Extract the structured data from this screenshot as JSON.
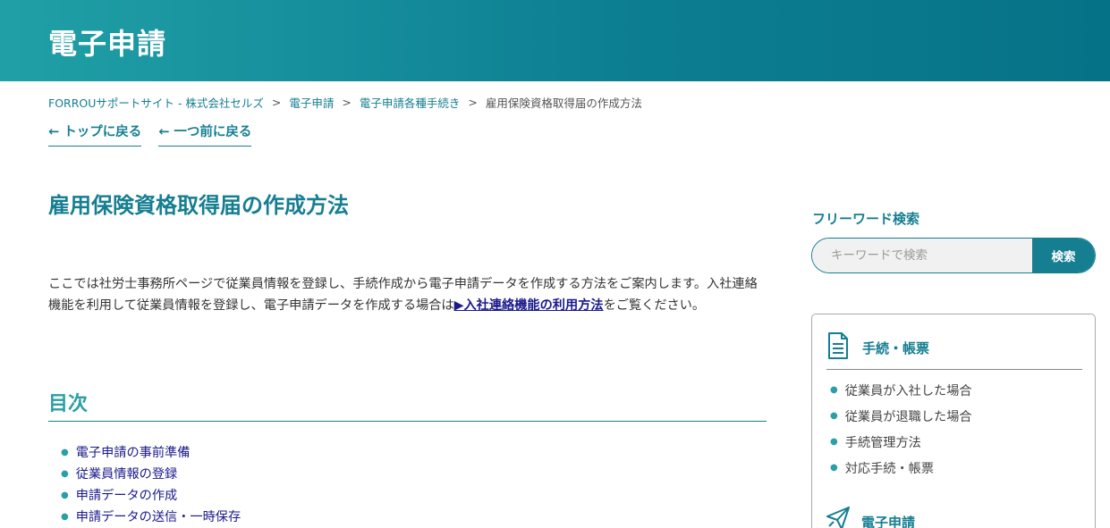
{
  "header": {
    "title": "電子申請"
  },
  "breadcrumb": {
    "items": [
      {
        "label": "FORROUサポートサイト - 株式会社セルズ"
      },
      {
        "label": "電子申請"
      },
      {
        "label": "電子申請各種手続き"
      }
    ],
    "current": "雇用保険資格取得届の作成方法",
    "separator": ">"
  },
  "backlinks": {
    "top": "← トップに戻る",
    "prev": "← 一つ前に戻る"
  },
  "page_title": "雇用保険資格取得届の作成方法",
  "intro": {
    "text_before": "ここでは社労士事務所ページで従業員情報を登録し、手続作成から電子申請データを作成する方法をご案内します。入社連絡機能を利用して従業員情報を登録し、電子申請データを作成する場合は",
    "link": "▶入社連絡機能の利用方法",
    "text_after": "をご覧ください。"
  },
  "toc": {
    "heading": "目次",
    "items": [
      {
        "label": "電子申請の事前準備"
      },
      {
        "label": "従業員情報の登録"
      },
      {
        "label": "申請データの作成"
      },
      {
        "label": "申請データの送信・一時保存"
      }
    ]
  },
  "sidebar": {
    "search_heading": "フリーワード検索",
    "search_placeholder": "キーワードで検索",
    "search_button": "検索",
    "category1": {
      "title": "手続・帳票",
      "icon": "document-icon",
      "items": [
        {
          "label": "従業員が入社した場合"
        },
        {
          "label": "従業員が退職した場合"
        },
        {
          "label": "手続管理方法"
        },
        {
          "label": "対応手続・帳票"
        }
      ]
    },
    "category2": {
      "title": "電子申請",
      "icon": "paper-plane-icon"
    }
  },
  "colors": {
    "accent": "#157e91",
    "accent_light": "#2aa0a6",
    "link": "#1a1a8c"
  }
}
